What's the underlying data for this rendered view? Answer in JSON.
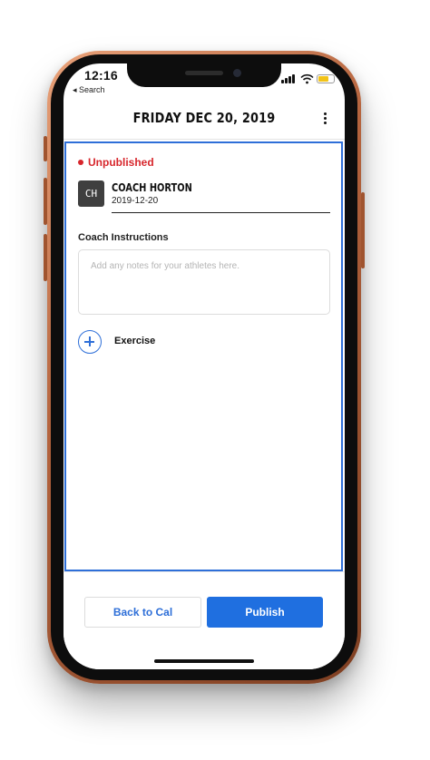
{
  "status_bar": {
    "time": "12:16",
    "back_label": "◂ Search"
  },
  "header": {
    "title": "FRIDAY DEC 20, 2019",
    "menu_icon": "more-vertical-icon"
  },
  "workout": {
    "status": "Unpublished",
    "status_color": "#d7262c",
    "coach_initials": "CH",
    "coach_name": "COACH HORTON",
    "date": "2019-12-20"
  },
  "instructions": {
    "label": "Coach Instructions",
    "placeholder": "Add any notes for your athletes here."
  },
  "add_exercise": {
    "label": "Exercise",
    "icon": "plus-circle-icon"
  },
  "footer": {
    "back_label": "Back to Cal",
    "publish_label": "Publish"
  },
  "colors": {
    "accent": "#1f6fe0",
    "frame_border": "#2e6fd8",
    "phone_body": "#b5643e"
  }
}
